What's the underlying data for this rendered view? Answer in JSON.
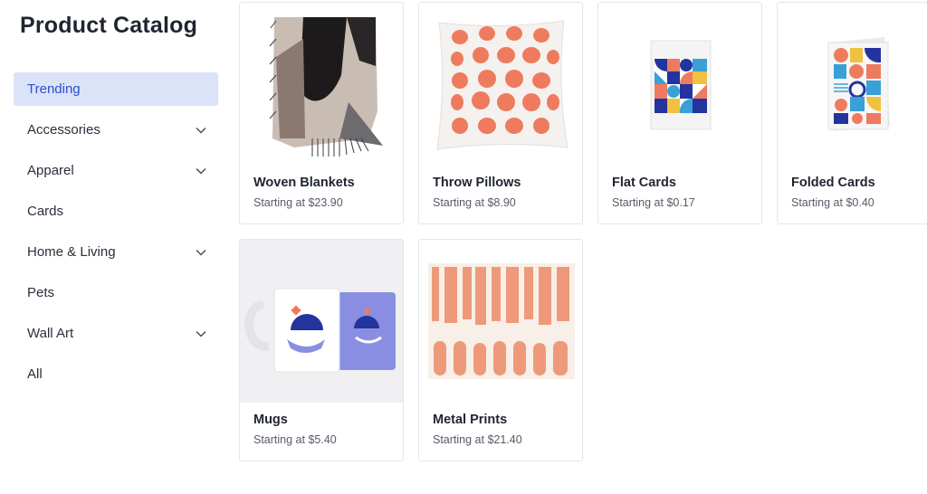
{
  "sidebar": {
    "title": "Product Catalog",
    "items": [
      {
        "label": "Trending",
        "expandable": false,
        "active": true
      },
      {
        "label": "Accessories",
        "expandable": true,
        "active": false
      },
      {
        "label": "Apparel",
        "expandable": true,
        "active": false
      },
      {
        "label": "Cards",
        "expandable": false,
        "active": false
      },
      {
        "label": "Home & Living",
        "expandable": true,
        "active": false
      },
      {
        "label": "Pets",
        "expandable": false,
        "active": false
      },
      {
        "label": "Wall Art",
        "expandable": true,
        "active": false
      },
      {
        "label": "All",
        "expandable": false,
        "active": false
      }
    ]
  },
  "products": [
    {
      "name": "Woven Blankets",
      "price": "Starting at $23.90",
      "image": "woven-blanket"
    },
    {
      "name": "Throw Pillows",
      "price": "Starting at $8.90",
      "image": "throw-pillow"
    },
    {
      "name": "Flat Cards",
      "price": "Starting at $0.17",
      "image": "flat-card"
    },
    {
      "name": "Folded Cards",
      "price": "Starting at $0.40",
      "image": "folded-card"
    },
    {
      "name": "Mugs",
      "price": "Starting at $5.40",
      "image": "mugs"
    },
    {
      "name": "Metal Prints",
      "price": "Starting at $21.40",
      "image": "metal-print"
    }
  ],
  "colors": {
    "active_bg": "#dae3f7",
    "active_text": "#2c4fce",
    "accent_coral": "#ee7b5e",
    "accent_navy": "#23349e",
    "accent_periwinkle": "#8a8ee2"
  }
}
